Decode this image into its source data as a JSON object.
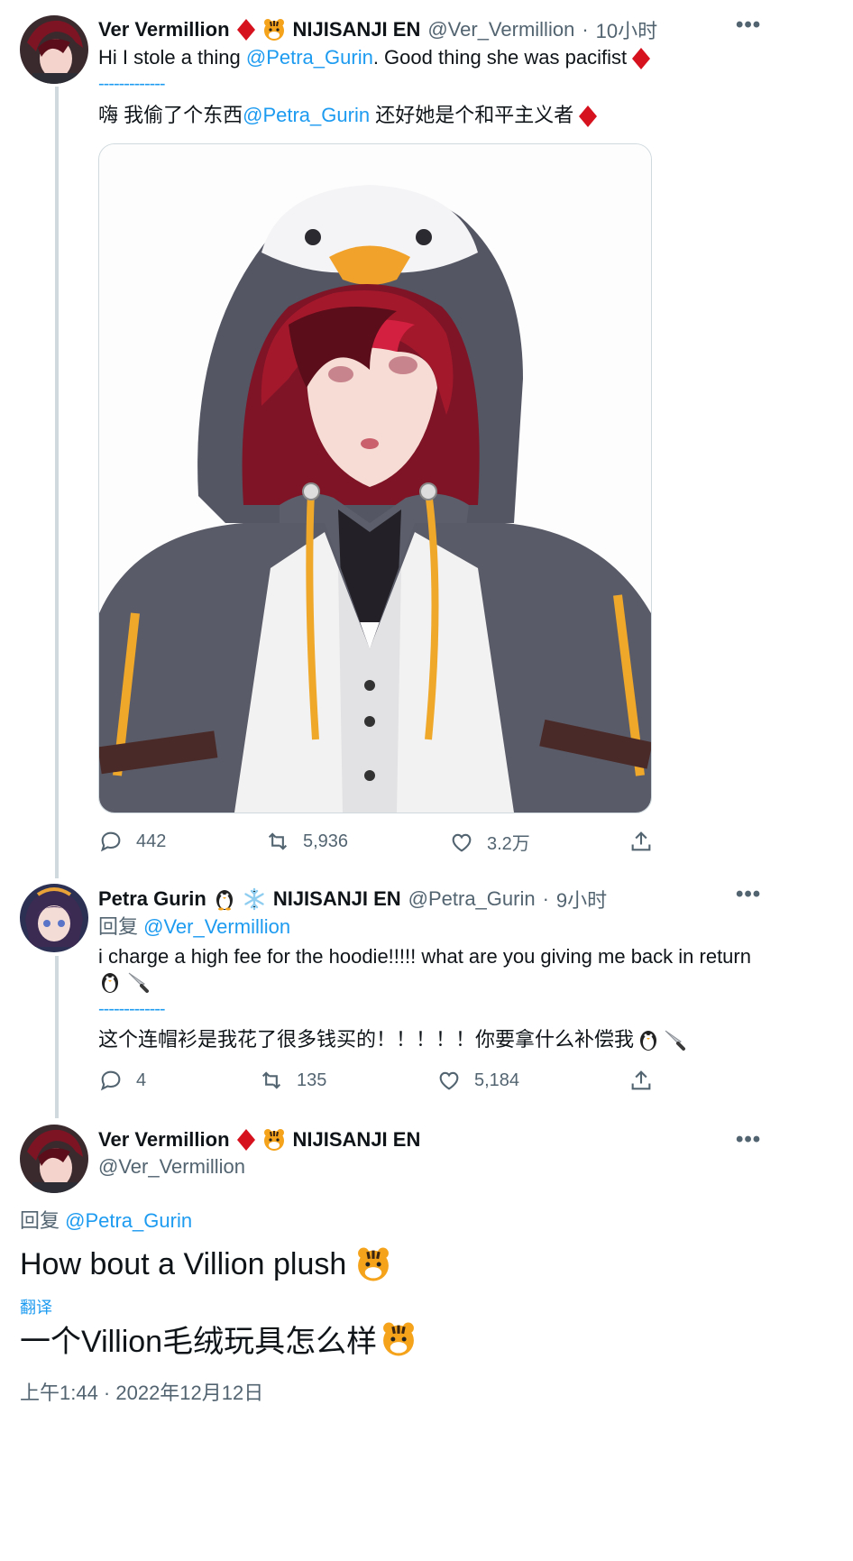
{
  "tweet1": {
    "name": "Ver Vermillion",
    "org": "NIJISANJI EN",
    "handle": "@Ver_Vermillion",
    "time": "10小时",
    "text_prefix": "Hi I stole a thing ",
    "mention": "@Petra_Gurin",
    "text_suffix": ". Good thing she was pacifist",
    "divider": "-------------",
    "zh_prefix": "嗨 我偷了个东西",
    "zh_mention": "@Petra_Gurin",
    "zh_suffix": " 还好她是个和平主义者",
    "replies": "442",
    "retweets": "5,936",
    "likes": "3.2万"
  },
  "tweet2": {
    "name": "Petra Gurin",
    "org": "NIJISANJI EN",
    "handle": "@Petra_Gurin",
    "time": "9小时",
    "reply_label": "回复 ",
    "reply_to": "@Ver_Vermillion",
    "text": "i charge a high fee for the hoodie!!!!! what are you giving me back in return",
    "divider": "-------------",
    "zh_text": "这个连帽衫是我花了很多钱买的！！！！！你要拿什么补偿我",
    "replies": "4",
    "retweets": "135",
    "likes": "5,184"
  },
  "tweet3": {
    "name": "Ver Vermillion",
    "org": "NIJISANJI EN",
    "handle": "@Ver_Vermillion",
    "reply_label": "回复 ",
    "reply_to": "@Petra_Gurin",
    "text": "How bout a Villion plush",
    "translate": "翻译",
    "zh_text": "一个Villion毛绒玩具怎么样",
    "timestamp": "上午1:44 · 2022年12月12日"
  },
  "colors": {
    "link": "#1d9bf0",
    "muted": "#536471",
    "diamond": "#d6121f"
  },
  "icons": [
    "more-icon",
    "reply-icon",
    "retweet-icon",
    "like-icon",
    "share-icon",
    "diamond-icon",
    "tiger-icon",
    "penguin-icon",
    "snowflake-icon",
    "knife-icon"
  ]
}
